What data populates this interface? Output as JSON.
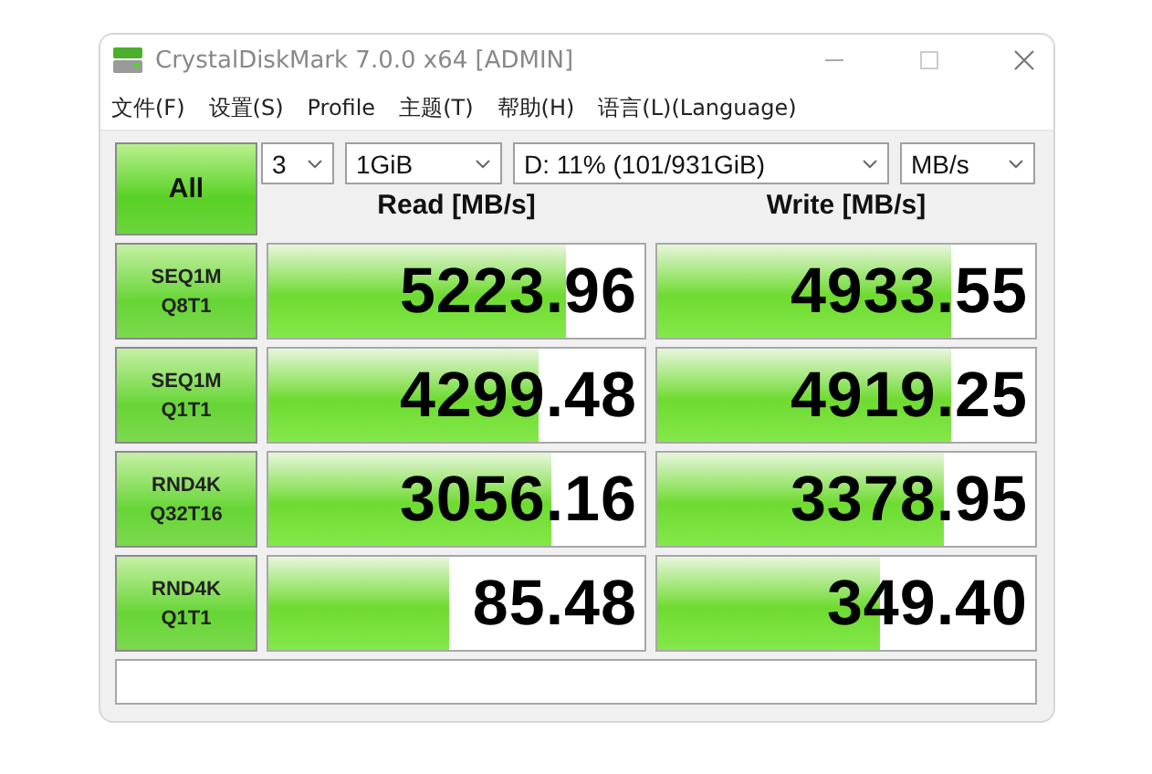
{
  "window": {
    "title": "CrystalDiskMark 7.0.0 x64 [ADMIN]"
  },
  "menu": [
    "文件(F)",
    "设置(S)",
    "Profile",
    "主题(T)",
    "帮助(H)",
    "语言(L)(Language)"
  ],
  "all_button": "All",
  "selectors": [
    {
      "value": "3"
    },
    {
      "value": "1GiB"
    },
    {
      "value": "D: 11% (101/931GiB)"
    },
    {
      "value": "MB/s"
    }
  ],
  "headers": [
    "Read [MB/s]",
    "Write [MB/s]"
  ],
  "rows": [
    {
      "label": [
        "SEQ1M",
        "Q8T1"
      ],
      "read": {
        "value": "5223.96",
        "level": 0.79
      },
      "write": {
        "value": "4933.55",
        "level": 0.78
      }
    },
    {
      "label": [
        "SEQ1M",
        "Q1T1"
      ],
      "read": {
        "value": "4299.48",
        "level": 0.72
      },
      "write": {
        "value": "4919.25",
        "level": 0.78
      }
    },
    {
      "label": [
        "RND4K",
        "Q32T16"
      ],
      "read": {
        "value": "3056.16",
        "level": 0.75
      },
      "write": {
        "value": "3378.95",
        "level": 0.76
      }
    },
    {
      "label": [
        "RND4K",
        "Q1T1"
      ],
      "read": {
        "value": "85.48",
        "level": 0.48
      },
      "write": {
        "value": "349.40",
        "level": 0.59
      }
    }
  ]
}
